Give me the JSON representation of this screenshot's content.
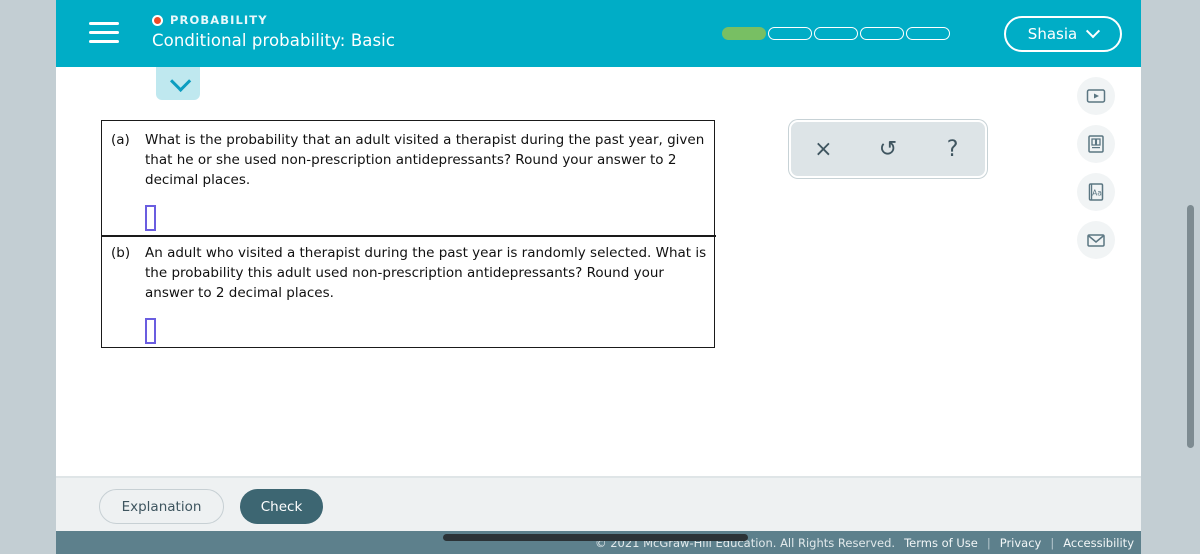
{
  "header": {
    "menu_icon": "hamburger-icon",
    "kicker": "PROBABILITY",
    "kicker_dot_color": "#f04a27",
    "topic": "Conditional probability: Basic",
    "background_color": "#00adc6",
    "progress": {
      "total": 5,
      "filled": 1,
      "fill_color": "#78bf63"
    },
    "account": {
      "name": "Shasia",
      "chevron": "chevron-down-icon"
    }
  },
  "collapse_tab": {
    "icon": "chevron-down-icon"
  },
  "question": {
    "parts": [
      {
        "label": "(a)",
        "text": "What is the probability that an adult visited a therapist during the past year, given that he or she used non-prescription antidepressants? Round your answer to 2 decimal places.",
        "answer_value": "",
        "answer_placeholder": ""
      },
      {
        "label": "(b)",
        "text": "An adult who visited a therapist during the past year is randomly selected. What is the probability this adult used non-prescription antidepressants? Round your answer to 2 decimal places.",
        "answer_value": "",
        "answer_placeholder": ""
      }
    ]
  },
  "math_toolbar": {
    "buttons": [
      {
        "name": "clear-button",
        "glyph": "×"
      },
      {
        "name": "undo-button",
        "glyph": "↺"
      },
      {
        "name": "help-button",
        "glyph": "?"
      }
    ]
  },
  "right_rail": {
    "items": [
      {
        "name": "video-icon",
        "label": "Video"
      },
      {
        "name": "ebook-icon",
        "label": "eBook"
      },
      {
        "name": "glossary-icon",
        "label": "Glossary"
      },
      {
        "name": "message-icon",
        "label": "Message"
      }
    ]
  },
  "actions": {
    "explanation_label": "Explanation",
    "check_label": "Check"
  },
  "footer": {
    "copyright": "© 2021 McGraw-Hill Education. All Rights Reserved.",
    "links": [
      "Terms of Use",
      "Privacy",
      "Accessibility"
    ],
    "separator": "|"
  }
}
